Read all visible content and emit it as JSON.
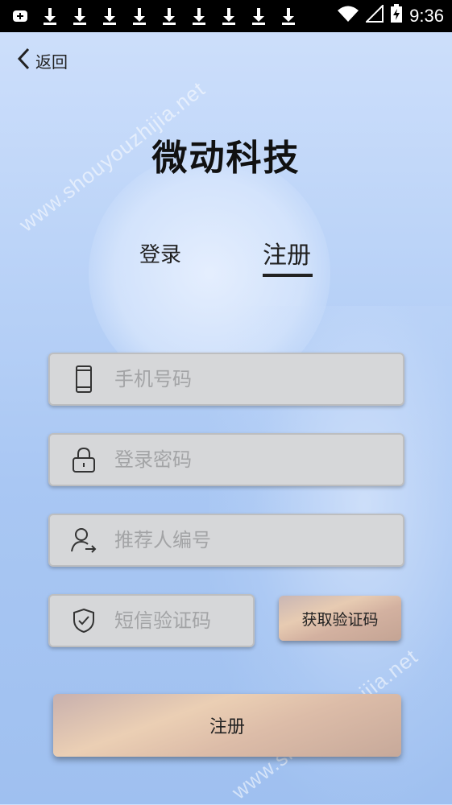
{
  "status_bar": {
    "time": "9:36",
    "left_icons": [
      "notification-plus-icon",
      "download-icon",
      "download-icon",
      "download-icon",
      "download-icon",
      "download-icon",
      "download-icon",
      "download-icon",
      "download-icon",
      "download-icon"
    ]
  },
  "nav": {
    "back_label": "返回"
  },
  "app_title": "微动科技",
  "tabs": {
    "login": "登录",
    "register": "注册",
    "active": "register"
  },
  "form": {
    "phone_placeholder": "手机号码",
    "password_placeholder": "登录密码",
    "referrer_placeholder": "推荐人编号",
    "sms_code_placeholder": "短信验证码",
    "get_code_label": "获取验证码",
    "submit_label": "注册"
  },
  "watermark": {
    "text": "www.shouyouzhijia.net"
  },
  "colors": {
    "field_bg": "#d6d7d9",
    "button_gold": "#e7cbb2",
    "status_bar": "#000000"
  }
}
